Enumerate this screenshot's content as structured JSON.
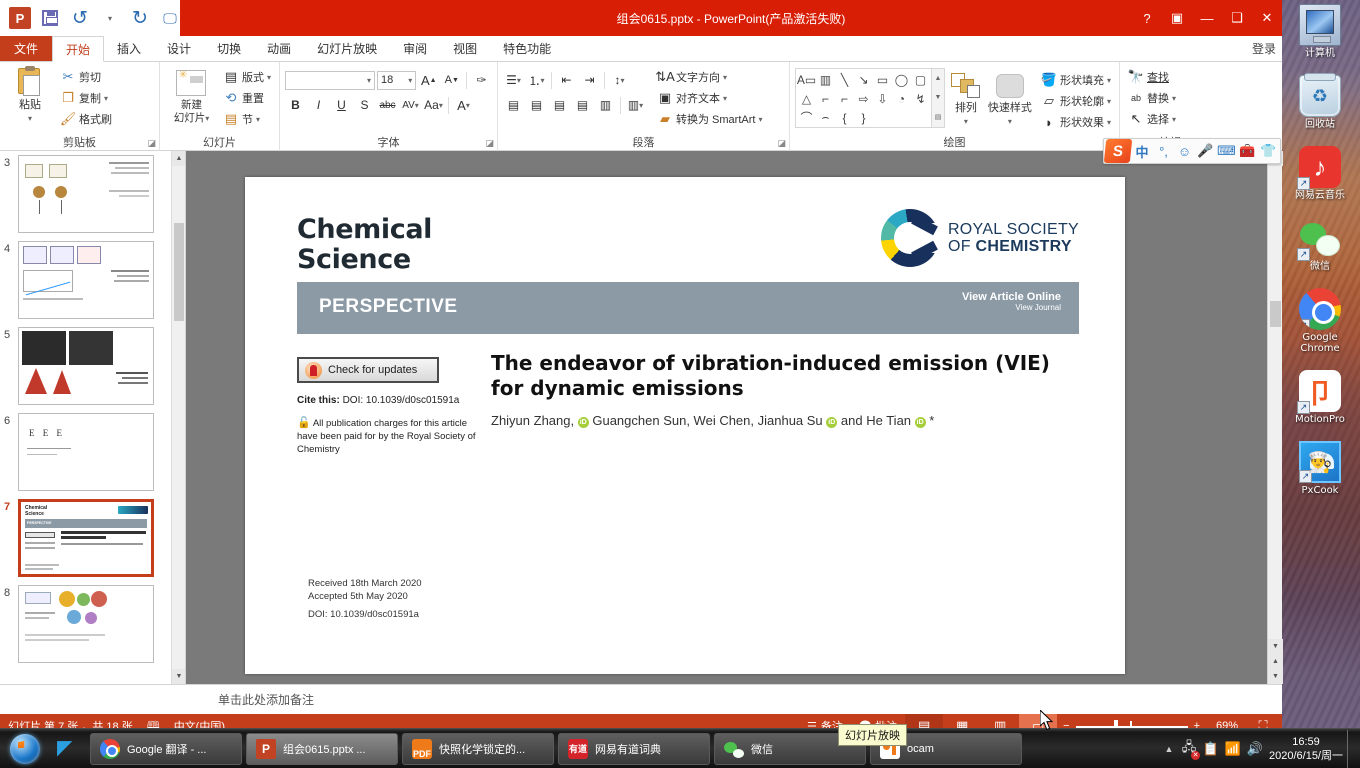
{
  "window": {
    "title": "组会0615.pptx -  PowerPoint(产品激活失败)",
    "min_label": "—",
    "max_label": "❑",
    "close_label": "✕",
    "help_label": "?",
    "ribbon_display_label": "▣",
    "signin_label": "登录"
  },
  "quick_access": {
    "app_logo": "P",
    "save_icon": "save-icon",
    "undo_label": "↺",
    "redo_label": "↻",
    "start_show_label": "▭",
    "more_label": "▾"
  },
  "tabs": [
    {
      "label": "文件",
      "kind": "file"
    },
    {
      "label": "开始",
      "active": true
    },
    {
      "label": "插入"
    },
    {
      "label": "设计"
    },
    {
      "label": "切换"
    },
    {
      "label": "动画"
    },
    {
      "label": "幻灯片放映"
    },
    {
      "label": "审阅"
    },
    {
      "label": "视图"
    },
    {
      "label": "特色功能"
    }
  ],
  "ribbon": {
    "groups": [
      {
        "name": "clipboard",
        "title": "剪贴板",
        "big": {
          "label": "粘贴",
          "caret": "▾"
        },
        "items": [
          {
            "label": "剪切",
            "icon": "✂"
          },
          {
            "label": "复制",
            "icon": "❐",
            "caret": "▾"
          },
          {
            "label": "格式刷",
            "icon": "🖌"
          }
        ],
        "launcher": "◪"
      },
      {
        "name": "slides",
        "title": "幻灯片",
        "big": {
          "label": "新建\n幻灯片",
          "caret": "▾"
        },
        "items": [
          {
            "label": "版式",
            "icon": "▤",
            "caret": "▾"
          },
          {
            "label": "重置",
            "icon": "↺"
          },
          {
            "label": "节",
            "icon": "▤",
            "caret": "▾"
          }
        ]
      },
      {
        "name": "font",
        "title": "字体",
        "font_name": "",
        "font_size": "18",
        "grow_label": "A",
        "shrink_label": "A",
        "clear_format_label": "✑",
        "buttons": [
          "B",
          "I",
          "U",
          "S",
          "abc",
          "AV",
          "Aa",
          "A"
        ],
        "launcher": "◪"
      },
      {
        "name": "paragraph",
        "title": "段落",
        "items": [
          {
            "label": "文字方向",
            "caret": "▾"
          },
          {
            "label": "对齐文本",
            "caret": "▾"
          },
          {
            "label": "转换为 SmartArt",
            "caret": "▾"
          }
        ],
        "launcher": "◪"
      },
      {
        "name": "drawing",
        "title": "绘图",
        "shapes": [
          "A▭",
          "▥",
          "╲",
          "↘",
          "▭",
          "◯",
          "▢",
          "△",
          "⌐",
          "⌐",
          "⇨",
          "⇩",
          "◔",
          "↯",
          "⌒",
          "⌢",
          "{",
          "}"
        ],
        "arrange_label": "排列",
        "arrange_caret": "▾",
        "quickstyle_label": "快速样式",
        "quickstyle_caret": "▾",
        "items": [
          {
            "label": "形状填充",
            "caret": "▾"
          },
          {
            "label": "形状轮廓",
            "caret": "▾"
          },
          {
            "label": "形状效果",
            "caret": "▾"
          }
        ],
        "launcher": "◪"
      },
      {
        "name": "editing",
        "title": "编辑",
        "items": [
          {
            "label": "查找",
            "icon": "🔍"
          },
          {
            "label": "替换",
            "icon": "ab",
            "caret": "▾"
          },
          {
            "label": "选择",
            "icon": "➤",
            "caret": "▾"
          }
        ]
      }
    ]
  },
  "thumbnails": [
    {
      "num": "3"
    },
    {
      "num": "4"
    },
    {
      "num": "5"
    },
    {
      "num": "6"
    },
    {
      "num": "7",
      "selected": true
    },
    {
      "num": "8"
    }
  ],
  "slide": {
    "journal_title_line1": "Chemical",
    "journal_title_line2": "Science",
    "publisher_line1": "ROYAL SOCIETY",
    "publisher_line2_a": "OF ",
    "publisher_line2_b": "CHEMISTRY",
    "article_type": "PERSPECTIVE",
    "view_article_online": "View Article Online",
    "view_journal": "View Journal",
    "check_for_updates": "Check for updates",
    "cite_this_label": "Cite this:",
    "cite_this_value": "DOI: 10.1039/d0sc01591a",
    "open_access_note": "All publication charges for this article have been paid for by the Royal Society of Chemistry",
    "paper_title": "The endeavor of vibration-induced emission (VIE) for dynamic emissions",
    "authors_prefix": "Zhiyun Zhang,",
    "authors_mid": " Guangchen Sun, Wei Chen, Jianhua Su",
    "authors_suffix": " and He Tian",
    "authors_star": "*",
    "orcid_label": "iD",
    "received": "Received 18th March 2020",
    "accepted": "Accepted 5th May 2020",
    "doi": "DOI: 10.1039/d0sc01591a"
  },
  "notes": {
    "placeholder": "单击此处添加备注"
  },
  "statusbar": {
    "slide_info": "幻灯片 第 7 张 ，共 18 张",
    "language_icon": "spellcheck-icon",
    "language": "中文(中国)",
    "notes_button": "备注",
    "comments_button": "批注",
    "views": [
      {
        "name": "normal-view",
        "glyph": "▤",
        "active": true
      },
      {
        "name": "slide-sorter-view",
        "glyph": "▦"
      },
      {
        "name": "reading-view",
        "glyph": "▥"
      },
      {
        "name": "slide-show-view",
        "glyph": "▭",
        "hover": true
      }
    ],
    "zoom_out": "−",
    "zoom_in": "+",
    "zoom_percent": "69%",
    "fit_slide": "⛶"
  },
  "ime": {
    "logo": "S",
    "mode": "中",
    "punct": "°,",
    "emoji": "☺",
    "voice": "🎤",
    "keyboard": "⌨",
    "toolbox": "🧰",
    "skin": "👕"
  },
  "desktop_icons": [
    {
      "label": "计算机",
      "icon": "computer-icon",
      "shortcut": false
    },
    {
      "label": "回收站",
      "icon": "recycle-bin-icon",
      "shortcut": false
    },
    {
      "label": "网易云音乐",
      "icon": "netease-music-icon",
      "shortcut": true
    },
    {
      "label": "微信",
      "icon": "wechat-icon",
      "shortcut": true
    },
    {
      "label": "Google Chrome",
      "icon": "chrome-icon",
      "shortcut": true
    },
    {
      "label": "MotionPro",
      "icon": "motionpro-icon",
      "shortcut": true
    },
    {
      "label": "PxCook",
      "icon": "pxcook-icon",
      "shortcut": true
    }
  ],
  "taskbar": {
    "buttons": [
      {
        "label": "Google 翻译 - ...",
        "icon": "chrome-icon"
      },
      {
        "label": "组会0615.pptx ...",
        "icon": "powerpoint-icon",
        "active": true
      },
      {
        "label": "快照化学锁定的...",
        "icon": "pdf-icon"
      },
      {
        "label": "网易有道词典",
        "icon": "youdao-icon"
      },
      {
        "label": "微信",
        "icon": "wechat-icon"
      },
      {
        "label": "ocam",
        "icon": "ocam-icon"
      }
    ],
    "tooltip": "幻灯片放映",
    "tray_time": "16:59",
    "tray_date": "2020/6/15/周一"
  }
}
